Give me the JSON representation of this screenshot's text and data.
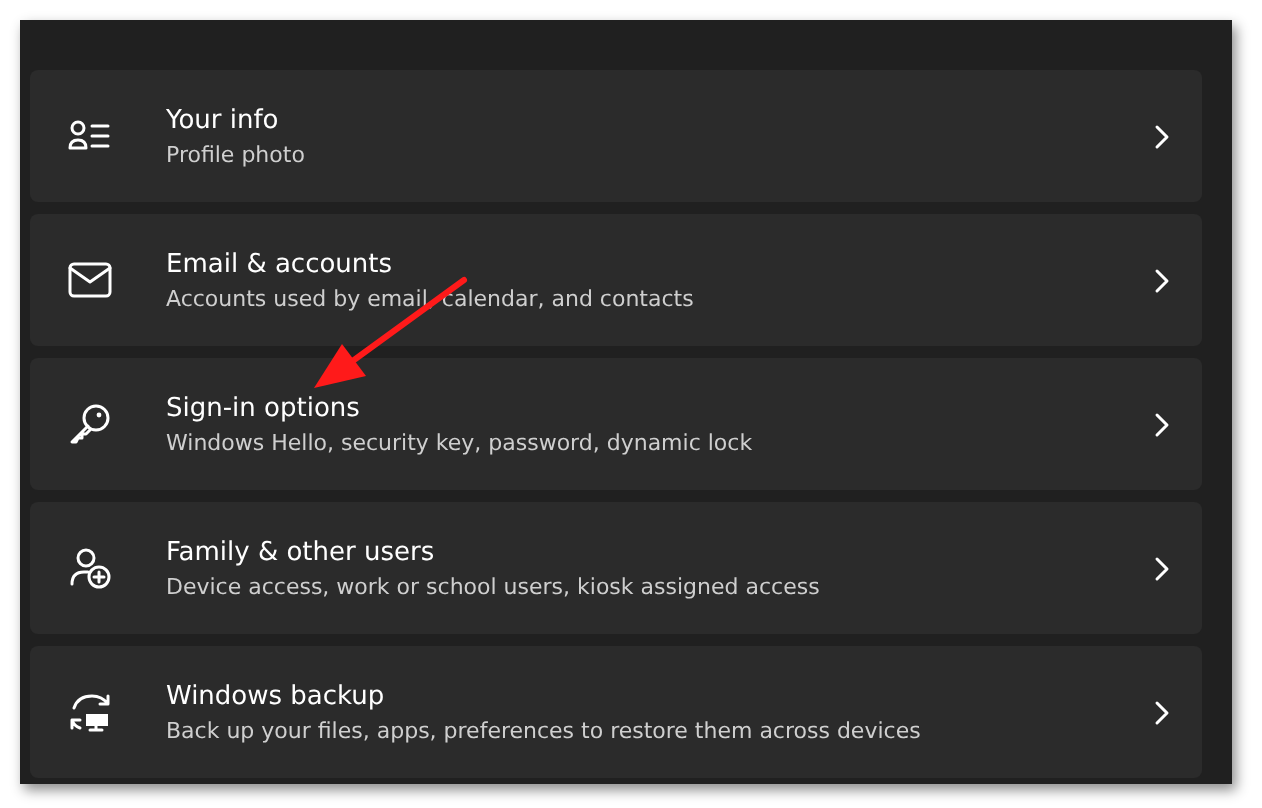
{
  "items": [
    {
      "kind": "info",
      "title": "Your info",
      "subtitle": "Profile photo"
    },
    {
      "kind": "email",
      "title": "Email & accounts",
      "subtitle": "Accounts used by email, calendar, and contacts"
    },
    {
      "kind": "key",
      "title": "Sign-in options",
      "subtitle": "Windows Hello, security key, password, dynamic lock"
    },
    {
      "kind": "family",
      "title": "Family & other users",
      "subtitle": "Device access, work or school users, kiosk assigned access"
    },
    {
      "kind": "backup",
      "title": "Windows backup",
      "subtitle": "Back up your files, apps, preferences to restore them across devices"
    }
  ]
}
